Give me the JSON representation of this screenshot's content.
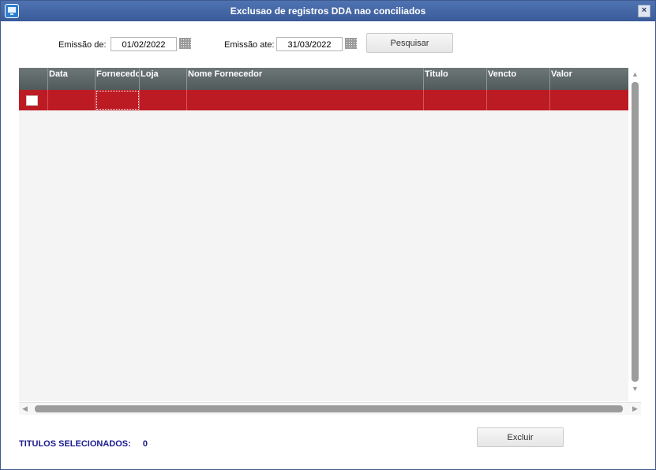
{
  "window": {
    "title": "Exclusao de registros DDA nao conciliados"
  },
  "filters": {
    "from_label": "Emissão de:",
    "from_value": "01/02/2022",
    "to_label": "Emissão ate:",
    "to_value": "31/03/2022",
    "search_label": "Pesquisar"
  },
  "table": {
    "columns": [
      "",
      "Data",
      "Fornecedor",
      "Loja",
      "Nome Fornecedor",
      "Titulo",
      "Vencto",
      "Valor"
    ],
    "rows": [
      {
        "selected": false,
        "data": "",
        "fornecedor": "",
        "loja": "",
        "nome_fornecedor": "",
        "titulo": "",
        "vencto": "",
        "valor": ""
      }
    ],
    "row_color": "#bc1b24"
  },
  "footer": {
    "selected_label": "TITULOS SELECIONADOS:",
    "selected_count": "0",
    "delete_label": "Excluir"
  },
  "colors": {
    "titlebar": "#4468a8",
    "header": "#5e6768",
    "status_text": "#1c1c8e"
  }
}
